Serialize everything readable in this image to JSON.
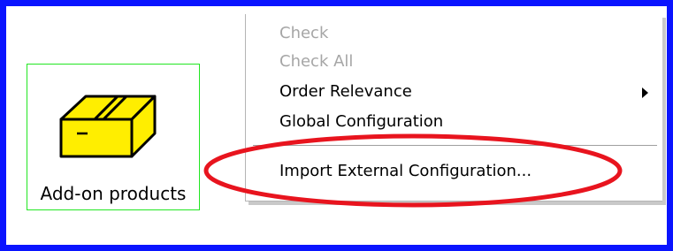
{
  "product": {
    "label": "Add-on products",
    "icon": "package-box-icon"
  },
  "menu": {
    "items": [
      {
        "label": "Check",
        "enabled": false
      },
      {
        "label": "Check All",
        "enabled": false
      },
      {
        "label": "Order Relevance",
        "enabled": true,
        "has_submenu": true
      },
      {
        "label": "Global Configuration",
        "enabled": true
      },
      {
        "label": "Import External Configuration...",
        "enabled": true,
        "highlighted": true
      }
    ]
  },
  "colors": {
    "window_border": "#0a14ff",
    "selection_border": "#22e622",
    "highlight_ellipse": "#e8141e",
    "disabled_text": "#a6a6a6",
    "box_fill": "#ffee00"
  }
}
